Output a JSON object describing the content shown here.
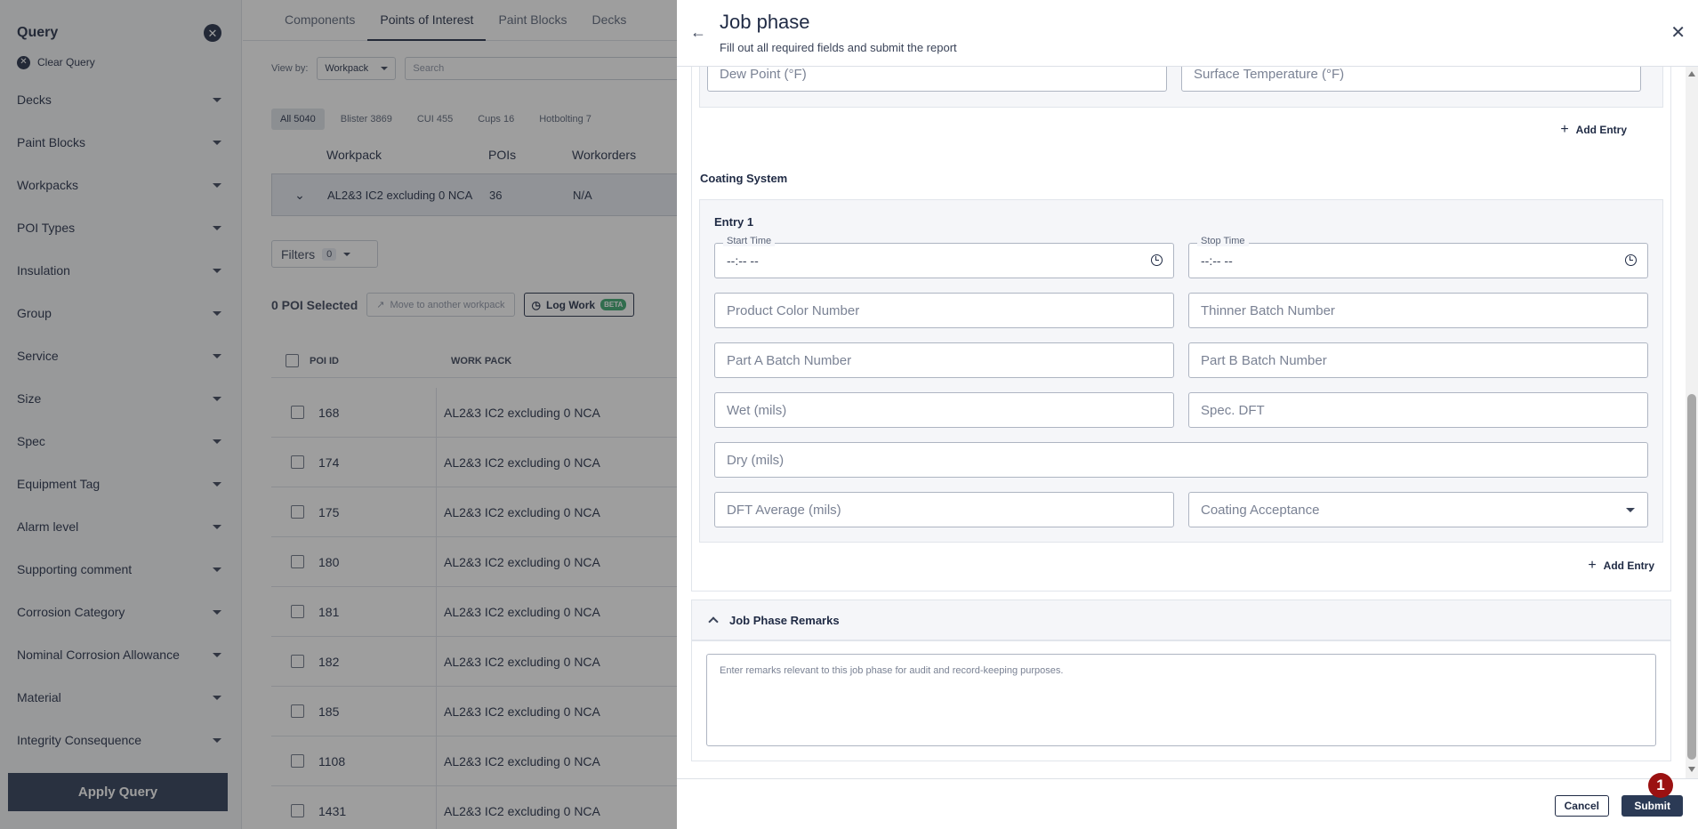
{
  "sidebar": {
    "title": "Query",
    "clear_label": "Clear Query",
    "items": [
      "Decks",
      "Paint Blocks",
      "Workpacks",
      "POI Types",
      "Insulation",
      "Group",
      "Service",
      "Size",
      "Spec",
      "Equipment Tag",
      "Alarm level",
      "Supporting comment",
      "Corrosion Category",
      "Nominal Corrosion Allowance",
      "Material",
      "Integrity Consequence"
    ],
    "apply_label": "Apply Query"
  },
  "main": {
    "tabs": [
      "Components",
      "Points of Interest",
      "Paint Blocks",
      "Decks"
    ],
    "active_tab": "Points of Interest",
    "view_by_label": "View by:",
    "view_by_value": "Workpack",
    "search_placeholder": "Search",
    "chips": [
      "All 5040",
      "Blister 3869",
      "CUI 455",
      "Cups 16",
      "Hotbolting 7"
    ],
    "workpack_headers": [
      "Workpack",
      "POIs",
      "Workorders"
    ],
    "workpack_row": {
      "name": "AL2&3 IC2 excluding 0 NCA",
      "pois": "36",
      "workorders": "N/A"
    },
    "filters_label": "Filters",
    "filters_count": "0",
    "selected_text": "0 POI Selected",
    "move_label": "Move to another workpack",
    "log_work_label": "Log Work",
    "beta_label": "BETA",
    "table_headers": [
      "POI ID",
      "WORK PACK"
    ],
    "rows": [
      {
        "id": "168",
        "pack": "AL2&3 IC2 excluding 0 NCA"
      },
      {
        "id": "174",
        "pack": "AL2&3 IC2 excluding 0 NCA"
      },
      {
        "id": "175",
        "pack": "AL2&3 IC2 excluding 0 NCA"
      },
      {
        "id": "180",
        "pack": "AL2&3 IC2 excluding 0 NCA"
      },
      {
        "id": "181",
        "pack": "AL2&3 IC2 excluding 0 NCA"
      },
      {
        "id": "182",
        "pack": "AL2&3 IC2 excluding 0 NCA"
      },
      {
        "id": "185",
        "pack": "AL2&3 IC2 excluding 0 NCA"
      },
      {
        "id": "1108",
        "pack": "AL2&3 IC2 excluding 0 NCA"
      },
      {
        "id": "1431",
        "pack": "AL2&3 IC2 excluding 0 NCA"
      }
    ]
  },
  "drawer": {
    "title": "Job phase",
    "subtitle": "Fill out all required fields and submit the report",
    "env": {
      "dew_point": "Dew Point (°F)",
      "surface_temp": "Surface Temperature (°F)"
    },
    "add_entry_label": "Add Entry",
    "coating_title": "Coating System",
    "entry_title": "Entry 1",
    "start_time_label": "Start Time",
    "stop_time_label": "Stop Time",
    "time_placeholder": "--:-- --",
    "fields": {
      "product_color": "Product Color Number",
      "thinner_batch": "Thinner Batch Number",
      "part_a": "Part A Batch Number",
      "part_b": "Part B Batch Number",
      "wet": "Wet (mils)",
      "spec_dft": "Spec. DFT",
      "dry": "Dry (mils)",
      "dft_avg": "DFT Average (mils)",
      "coating_acceptance": "Coating Acceptance"
    },
    "remarks_title": "Job Phase Remarks",
    "remarks_placeholder": "Enter remarks relevant to this job phase for audit and record-keeping purposes.",
    "cancel_label": "Cancel",
    "submit_label": "Submit",
    "step_badge": "1"
  },
  "colors": {
    "primary": "#2b3a55",
    "badge": "#9b1111",
    "beta": "#3aa76d"
  }
}
